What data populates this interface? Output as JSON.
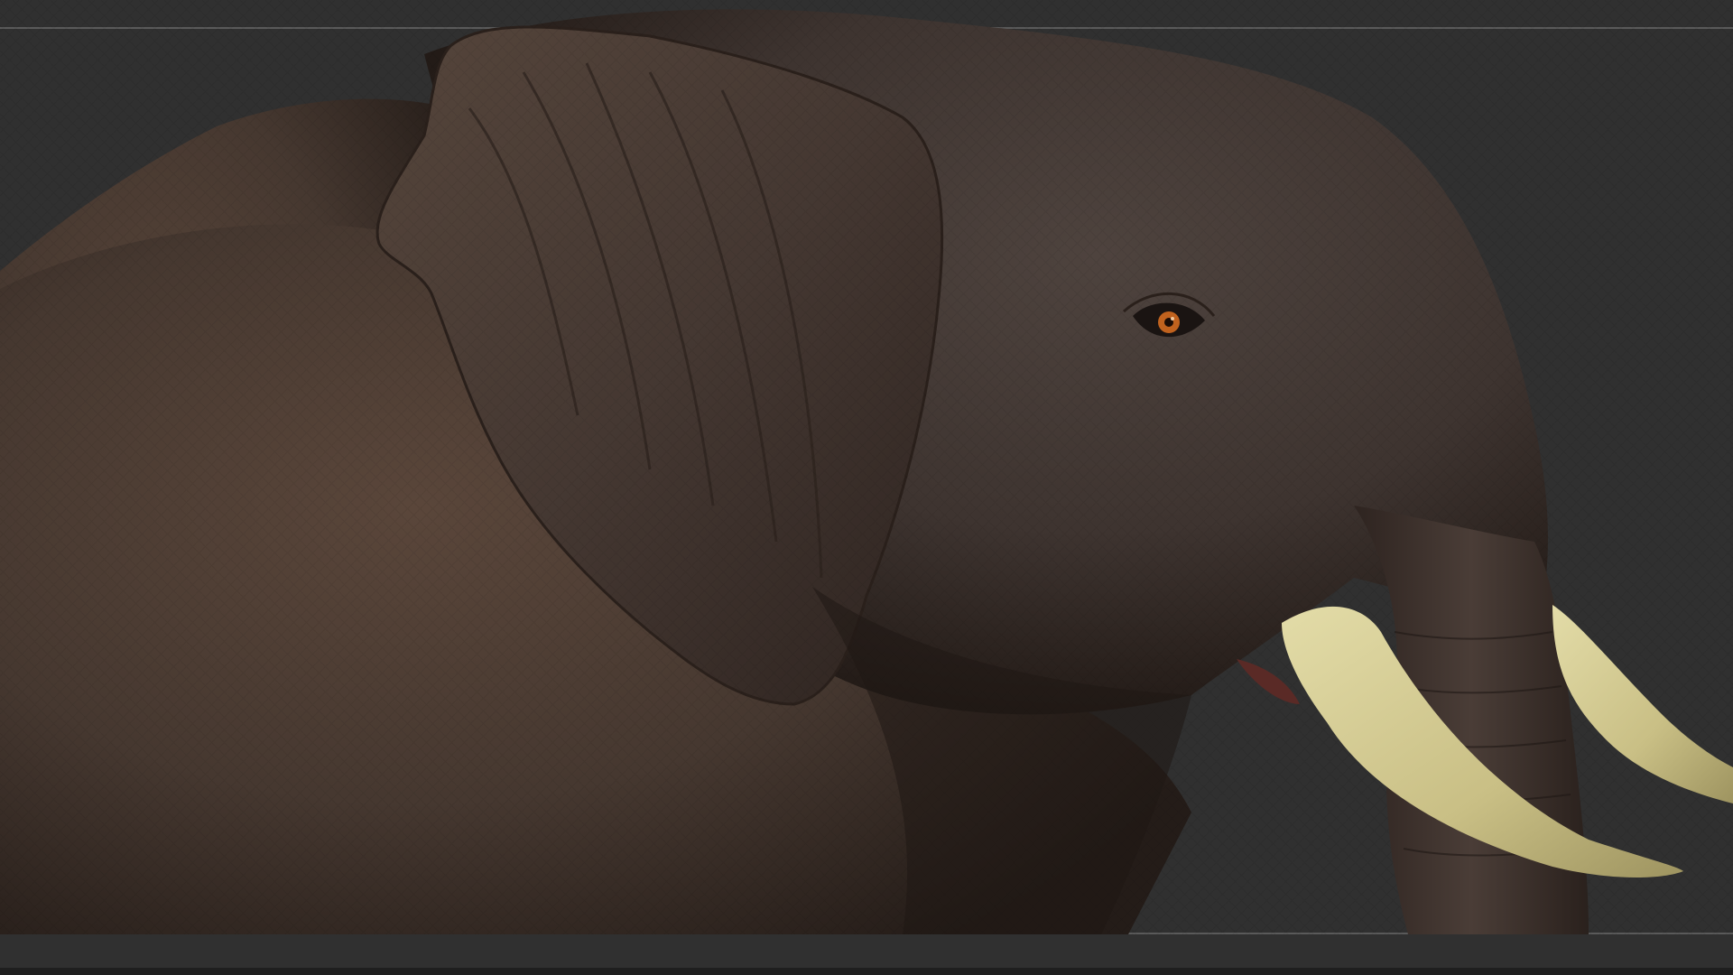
{
  "viewport": {
    "background_color": "#303030",
    "frame_line_color": "#5a5a5a",
    "model_subject": "elephant-sculpt",
    "skin_color": "#4a3a31",
    "tusk_color": "#d9cf98",
    "eye_color": "#c0621e"
  }
}
